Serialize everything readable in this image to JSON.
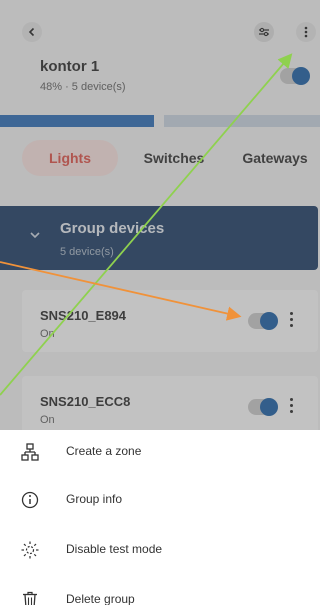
{
  "header": {
    "title": "kontor 1",
    "subtitle": "48% · 5 device(s)",
    "toggle_on": true
  },
  "progress": {
    "percent": 48
  },
  "tabs": [
    {
      "label": "Lights",
      "active": true
    },
    {
      "label": "Switches",
      "active": false
    },
    {
      "label": "Gateways",
      "active": false
    }
  ],
  "group": {
    "title": "Group devices",
    "subtitle": "5 device(s)"
  },
  "devices": [
    {
      "name": "SNS210_E894",
      "state": "On",
      "toggle_on": true
    },
    {
      "name": "SNS210_ECC8",
      "state": "On",
      "toggle_on": true
    }
  ],
  "menu": {
    "items": [
      {
        "label": "Create a zone",
        "icon": "zone-icon"
      },
      {
        "label": "Group info",
        "icon": "info-icon"
      },
      {
        "label": "Disable test mode",
        "icon": "test-mode-icon"
      },
      {
        "label": "Delete group",
        "icon": "trash-icon"
      }
    ]
  },
  "colors": {
    "accent": "#0a54a0",
    "tab_active": "#e0443a",
    "group_header": "#0b2e5a",
    "arrow_green": "#8fd14f",
    "arrow_orange": "#f0923a"
  }
}
